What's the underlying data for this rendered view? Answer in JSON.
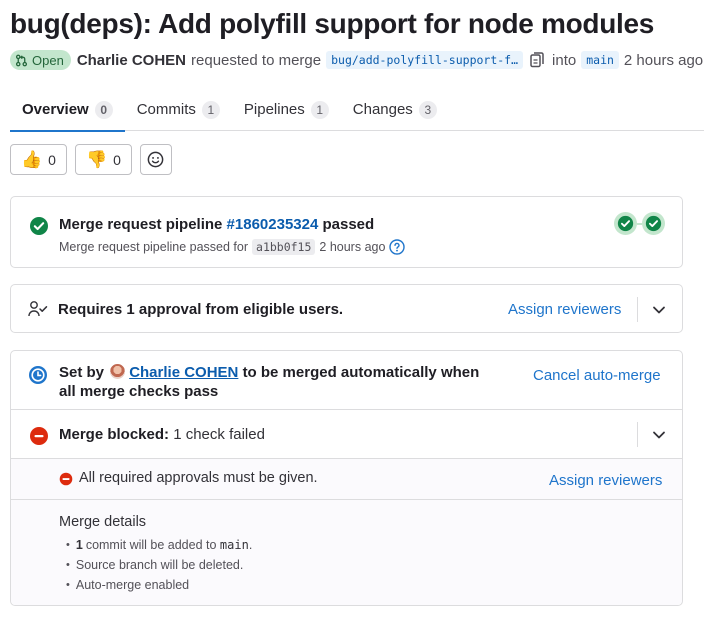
{
  "mr": {
    "title": "bug(deps): Add polyfill support for node modules",
    "status": "Open",
    "author": "Charlie COHEN",
    "requested_text": "requested to merge",
    "source_branch": "bug/add-polyfill-support-f…",
    "into_text": "into",
    "target_branch": "main",
    "time": "2 hours ago"
  },
  "tabs": [
    {
      "label": "Overview",
      "count": "0"
    },
    {
      "label": "Commits",
      "count": "1"
    },
    {
      "label": "Pipelines",
      "count": "1"
    },
    {
      "label": "Changes",
      "count": "3"
    }
  ],
  "reactions": {
    "thumbs_up_count": "0",
    "thumbs_down_count": "0"
  },
  "pipeline": {
    "prefix": "Merge request pipeline",
    "id": "#1860235324",
    "status": "passed",
    "sub_text": "Merge request pipeline passed for",
    "sha": "a1bb0f15",
    "time": "2 hours ago"
  },
  "approval": {
    "label": "Requires 1 approval from eligible users.",
    "assign_label": "Assign reviewers"
  },
  "auto_merge": {
    "set_by": "Set by",
    "user": "Charlie COHEN",
    "message": "to be merged automatically when all merge checks pass",
    "cancel_label": "Cancel auto-merge"
  },
  "blocked": {
    "label": "Merge blocked:",
    "detail": "1 check failed"
  },
  "requirement": {
    "text": "All required approvals must be given.",
    "assign_label": "Assign reviewers"
  },
  "merge_details": {
    "heading": "Merge details",
    "commit_count": "1",
    "commit_text": "commit will be added to",
    "commit_target": "main",
    "commit_suffix": ".",
    "items": [
      "Source branch will be deleted.",
      "Auto-merge enabled"
    ]
  },
  "colors": {
    "success": "#108548",
    "danger": "#dd2b0e",
    "link": "#1f75cb",
    "info": "#1f75cb"
  }
}
